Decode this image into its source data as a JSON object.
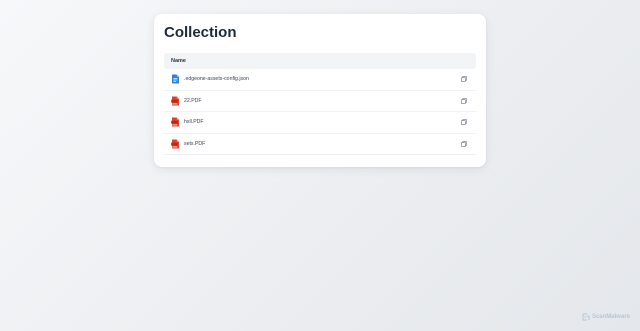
{
  "page": {
    "title": "Collection"
  },
  "table": {
    "header_name": "Name",
    "rows": [
      {
        "name": ".edgeone-assets-config.json",
        "icon": "json-file-icon"
      },
      {
        "name": "22.PDF",
        "icon": "pdf-file-icon"
      },
      {
        "name": "hxll.PDF",
        "icon": "pdf-file-icon"
      },
      {
        "name": "sets.PDF",
        "icon": "pdf-file-icon"
      }
    ]
  },
  "watermark": {
    "label": "ScanMalware"
  },
  "colors": {
    "json_icon": "#2f80ed",
    "pdf_icon": "#e0412f",
    "title_text": "#1e2a3a",
    "header_bg": "#f3f4f6",
    "watermark": "#b8c6d6"
  }
}
